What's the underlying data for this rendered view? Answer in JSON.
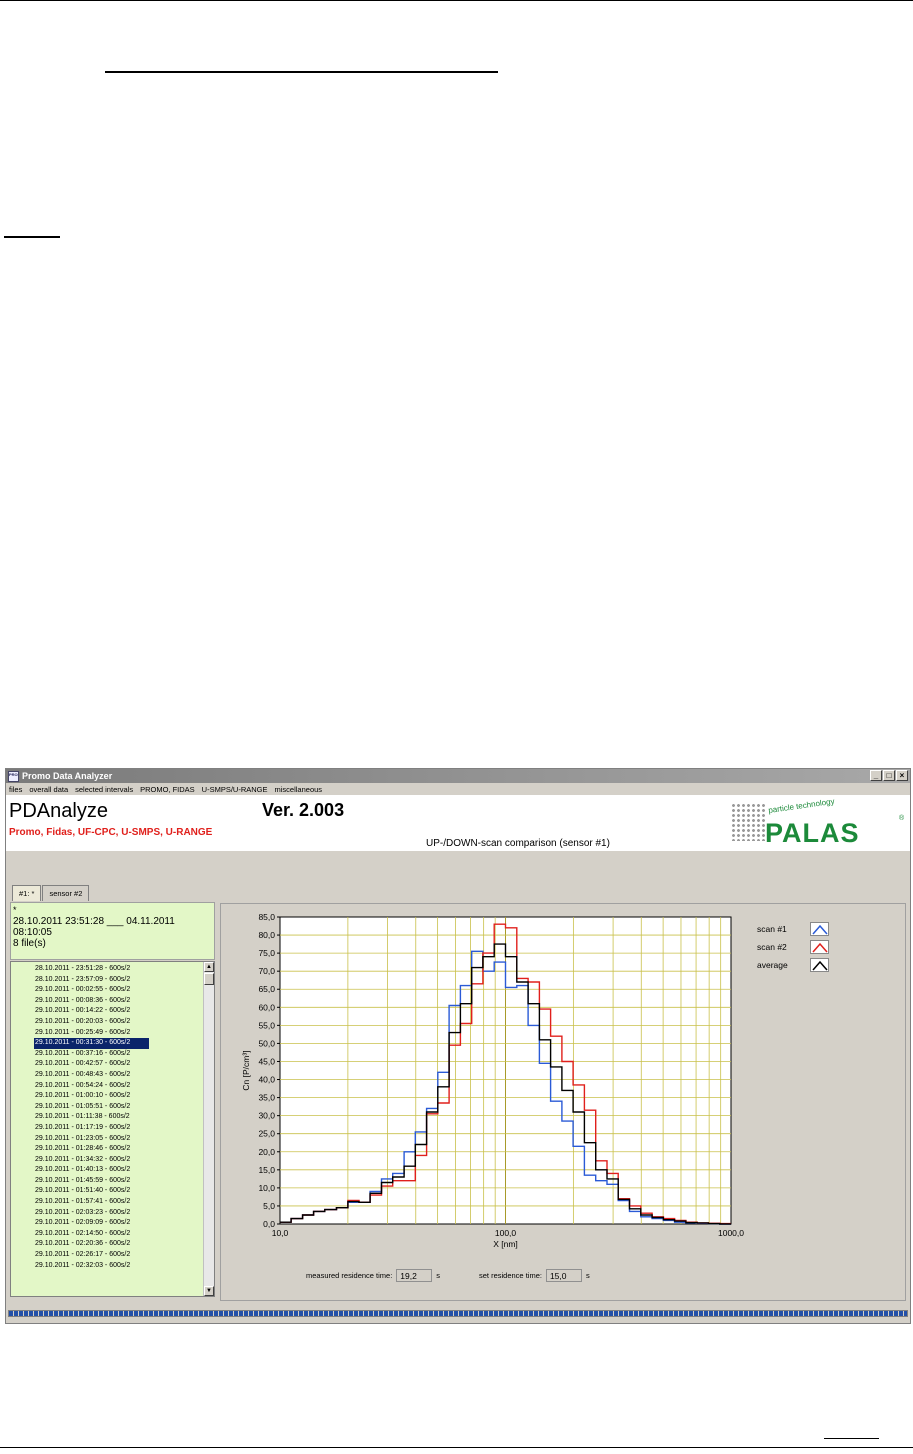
{
  "window": {
    "title": "Promo Data Analyzer",
    "icon_label": "PROMO",
    "controls": [
      "_",
      "□",
      "×"
    ]
  },
  "menu": [
    "files",
    "overall data",
    "selected intervals",
    "PROMO, FIDAS",
    "U-SMPS/U-RANGE",
    "miscellaneous"
  ],
  "header": {
    "app_name": "PDAnalyze",
    "version": "Ver. 2.003",
    "subtitle": "Promo, Fidas, UF-CPC, U-SMPS, U-RANGE",
    "view_title": "UP-/DOWN-scan comparison (sensor #1)",
    "logo_tagline": "particle technology",
    "logo_word": "PALAS",
    "logo_reg": "®"
  },
  "tabs": [
    "#1: *",
    "sensor #2"
  ],
  "info": {
    "asterisk": "*",
    "range": "28.10.2011 23:51:28 ___ 04.11.2011 08:10:05",
    "files": "8 file(s)"
  },
  "files": [
    "28.10.2011 - 23:51:28 - 600s/2",
    "28.10.2011 - 23:57:09 - 600s/2",
    "29.10.2011 - 00:02:55 - 600s/2",
    "29.10.2011 - 00:08:36 - 600s/2",
    "29.10.2011 - 00:14:22 - 600s/2",
    "29.10.2011 - 00:20:03 - 600s/2",
    "29.10.2011 - 00:25:49 - 600s/2",
    "29.10.2011 - 00:31:30 - 600s/2",
    "29.10.2011 - 00:37:16 - 600s/2",
    "29.10.2011 - 00:42:57 - 600s/2",
    "29.10.2011 - 00:48:43 - 600s/2",
    "29.10.2011 - 00:54:24 - 600s/2",
    "29.10.2011 - 01:00:10 - 600s/2",
    "29.10.2011 - 01:05:51 - 600s/2",
    "29.10.2011 - 01:11:38 - 600s/2",
    "29.10.2011 - 01:17:19 - 600s/2",
    "29.10.2011 - 01:23:05 - 600s/2",
    "29.10.2011 - 01:28:46 - 600s/2",
    "29.10.2011 - 01:34:32 - 600s/2",
    "29.10.2011 - 01:40:13 - 600s/2",
    "29.10.2011 - 01:45:59 - 600s/2",
    "29.10.2011 - 01:51:40 - 600s/2",
    "29.10.2011 - 01:57:41 - 600s/2",
    "29.10.2011 - 02:03:23 - 600s/2",
    "29.10.2011 - 02:09:09 - 600s/2",
    "29.10.2011 - 02:14:50 - 600s/2",
    "29.10.2011 - 02:20:36 - 600s/2",
    "29.10.2011 - 02:26:17 - 600s/2",
    "29.10.2011 - 02:32:03 - 600s/2"
  ],
  "selected_file_index": 7,
  "legend": {
    "items": [
      {
        "label": "scan #1",
        "color": "#2a5ad6"
      },
      {
        "label": "scan #2",
        "color": "#e0201c"
      },
      {
        "label": "average",
        "color": "#000000"
      }
    ]
  },
  "residence": {
    "measured_label": "measured residence time:",
    "measured_value": "19,2",
    "measured_unit": "s",
    "set_label": "set residence time:",
    "set_value": "15,0",
    "set_unit": "s"
  },
  "chart_data": {
    "type": "line",
    "step": true,
    "title": "UP-/DOWN-scan comparison (sensor #1)",
    "xlabel": "X [nm]",
    "ylabel": "Cn [P/cm³]",
    "x_scale": "log",
    "xlim": [
      10,
      1000
    ],
    "ylim": [
      0,
      85
    ],
    "x_ticks": [
      "10,0",
      "100,0",
      "1000,0"
    ],
    "y_ticks": [
      "0,0",
      "5,0",
      "10,0",
      "15,0",
      "20,0",
      "25,0",
      "30,0",
      "35,0",
      "40,0",
      "45,0",
      "50,0",
      "55,0",
      "60,0",
      "65,0",
      "70,0",
      "75,0",
      "80,0",
      "85,0"
    ],
    "grid": true,
    "x": [
      10.0,
      11.2,
      12.6,
      14.1,
      15.8,
      17.8,
      20.0,
      22.4,
      25.1,
      28.2,
      31.6,
      35.5,
      39.8,
      44.7,
      50.1,
      56.2,
      63.1,
      70.8,
      79.4,
      89.1,
      100.0,
      112.2,
      125.9,
      141.3,
      158.5,
      177.8,
      199.5,
      223.9,
      251.2,
      281.8,
      316.2,
      354.8,
      398.1,
      446.7,
      501.2,
      562.3,
      631.0,
      707.9,
      794.3,
      891.3
    ],
    "series": [
      {
        "name": "scan #1",
        "color": "#2a5ad6",
        "values": [
          0.5,
          1.5,
          2.5,
          3.5,
          4,
          4.5,
          6,
          6,
          9,
          12.5,
          14,
          20,
          25.5,
          32,
          42,
          60.5,
          66,
          75.5,
          70,
          72.5,
          65.5,
          66,
          55,
          44.5,
          34,
          28.5,
          21.5,
          13.5,
          12,
          11,
          6.5,
          3.5,
          2,
          1.5,
          1,
          0.5,
          0.3,
          0.2,
          0.1,
          0
        ]
      },
      {
        "name": "scan #2",
        "color": "#e0201c",
        "values": [
          0.5,
          1.5,
          2.5,
          3.5,
          4,
          4.5,
          6.5,
          6,
          8,
          10.5,
          12,
          12,
          19,
          30.5,
          33.5,
          49.5,
          55.5,
          66.5,
          75,
          83,
          82,
          68,
          67,
          59.5,
          52,
          45,
          38.5,
          31.5,
          17.5,
          14,
          7,
          5,
          3,
          2,
          1.5,
          1,
          0.5,
          0.3,
          0.2,
          0.1
        ]
      },
      {
        "name": "average",
        "color": "#000000",
        "values": [
          0.5,
          1.5,
          2.5,
          3.5,
          4,
          4.5,
          6.2,
          6,
          8.5,
          11.5,
          13,
          16,
          22,
          31,
          38,
          53,
          61,
          71,
          74,
          77.5,
          74,
          67,
          61,
          51,
          43.5,
          37,
          31,
          22.5,
          15,
          12.5,
          6.8,
          4.2,
          2.5,
          1.8,
          1.2,
          0.8,
          0.4,
          0.3,
          0.1,
          0
        ]
      }
    ]
  }
}
